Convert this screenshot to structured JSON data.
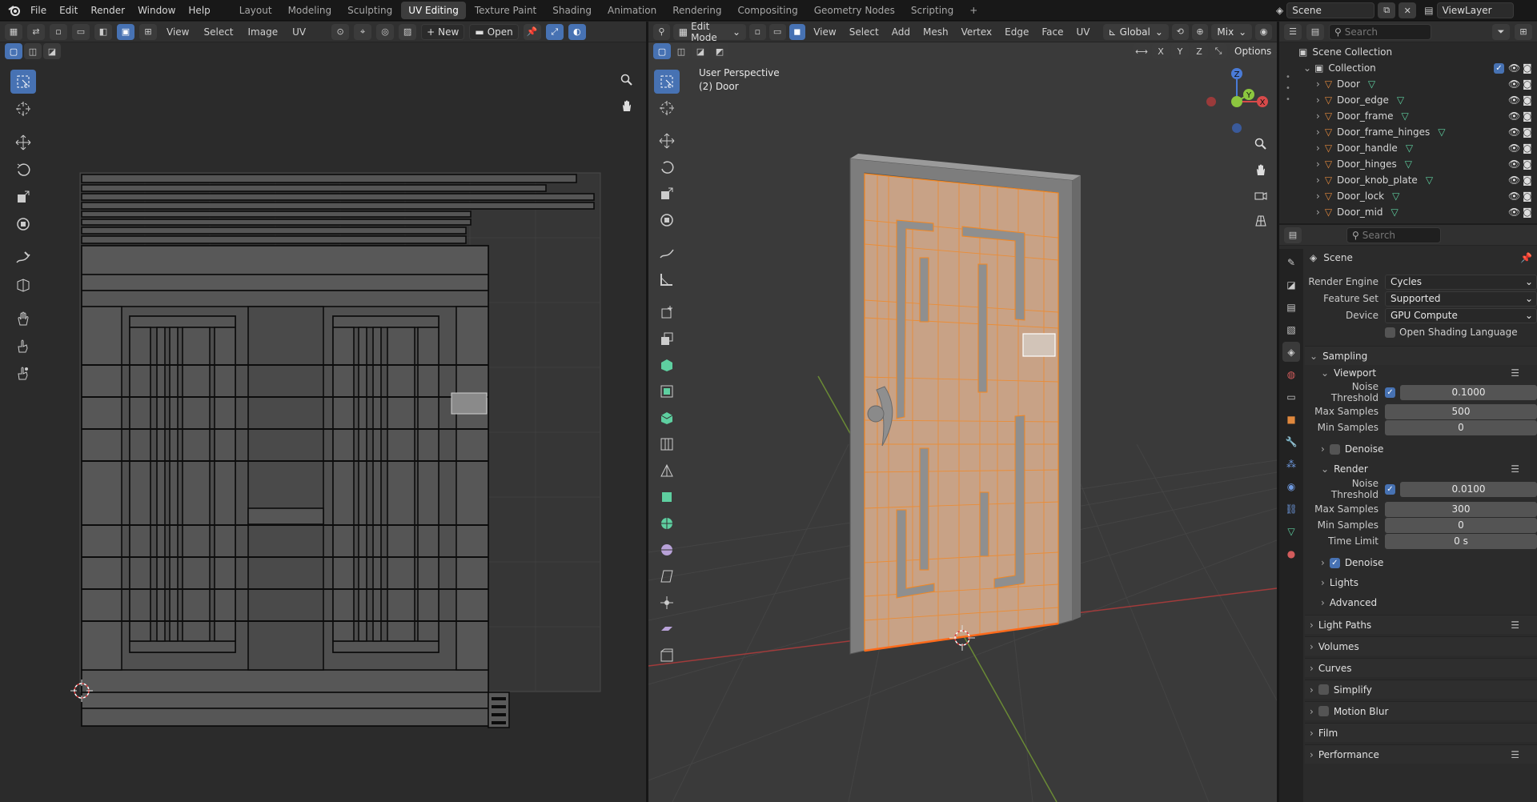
{
  "topbar": {
    "menus": [
      "File",
      "Edit",
      "Render",
      "Window",
      "Help"
    ],
    "workspaces": [
      "Layout",
      "Modeling",
      "Sculpting",
      "UV Editing",
      "Texture Paint",
      "Shading",
      "Animation",
      "Rendering",
      "Compositing",
      "Geometry Nodes",
      "Scripting"
    ],
    "active_workspace": "UV Editing",
    "scene_name": "Scene",
    "view_layer": "ViewLayer",
    "add_tab": "+"
  },
  "uv_editor": {
    "menus": [
      "View",
      "Select",
      "Image",
      "UV"
    ],
    "new_label": "New",
    "open_label": "Open"
  },
  "viewport": {
    "mode": "Edit Mode",
    "menus": [
      "View",
      "Select",
      "Add",
      "Mesh",
      "Vertex",
      "Edge",
      "Face",
      "UV"
    ],
    "transform": "Global",
    "shading": "Mix",
    "options_label": "Options",
    "overlay_title": "User Perspective",
    "overlay_sub": "(2) Door",
    "axis_labels": [
      "X",
      "Y",
      "Z"
    ],
    "gizmo": {
      "x": "X",
      "y": "Y",
      "z": "Z"
    },
    "accent": "#f5871f"
  },
  "outliner": {
    "search_placeholder": "Search",
    "root": "Scene Collection",
    "collection": "Collection",
    "objects": [
      "Door",
      "Door_edge",
      "Door_frame",
      "Door_frame_hinges",
      "Door_handle",
      "Door_hinges",
      "Door_knob_plate",
      "Door_lock",
      "Door_mid"
    ]
  },
  "properties": {
    "search_placeholder": "Search",
    "context": "Scene",
    "render_engine_label": "Render Engine",
    "render_engine": "Cycles",
    "feature_set_label": "Feature Set",
    "feature_set": "Supported",
    "device_label": "Device",
    "device": "GPU Compute",
    "osl_label": "Open Shading Language",
    "sampling": "Sampling",
    "viewport_panel": "Viewport",
    "noise_threshold_label": "Noise Threshold",
    "viewport_noise_threshold": "0.1000",
    "max_samples_label": "Max Samples",
    "viewport_max_samples": "500",
    "min_samples_label": "Min Samples",
    "viewport_min_samples": "0",
    "denoise_label": "Denoise",
    "render_panel": "Render",
    "render_noise_threshold": "0.0100",
    "render_max_samples": "300",
    "render_min_samples": "0",
    "time_limit_label": "Time Limit",
    "time_limit": "0 s",
    "lights": "Lights",
    "advanced": "Advanced",
    "light_paths": "Light Paths",
    "volumes": "Volumes",
    "curves": "Curves",
    "simplify": "Simplify",
    "motion_blur": "Motion Blur",
    "film": "Film",
    "performance": "Performance"
  },
  "colors": {
    "accent_blue": "#4772b3",
    "selection_orange": "#f5871f",
    "mesh_green": "#5ecfa0",
    "object_orange": "#e0883d"
  }
}
